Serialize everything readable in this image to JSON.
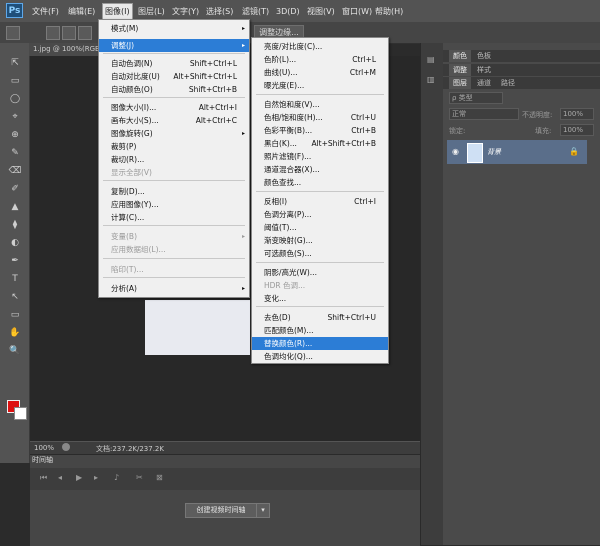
{
  "app": {
    "logo": "Ps"
  },
  "menubar": [
    "文件(F)",
    "编辑(E)",
    "图像(I)",
    "图层(L)",
    "文字(Y)",
    "选择(S)",
    "滤镜(T)",
    "3D(D)",
    "视图(V)",
    "窗口(W)",
    "帮助(H)"
  ],
  "options": {
    "refine_label": "调整边缘..."
  },
  "document": {
    "tab": "1.jpg @ 100%(RGB/8)",
    "zoom": "100%",
    "doc_size": "文档:237.2K/237.2K"
  },
  "image_menu": [
    {
      "label": "模式(M)",
      "shortcut": "",
      "arrow": "▸",
      "disabled": false,
      "hl": false
    },
    {
      "label": "调整(J)",
      "shortcut": "",
      "arrow": "▸",
      "disabled": false,
      "hl": true
    },
    {
      "label": "自动色调(N)",
      "shortcut": "Shift+Ctrl+L",
      "arrow": "",
      "disabled": false,
      "hl": false
    },
    {
      "label": "自动对比度(U)",
      "shortcut": "Alt+Shift+Ctrl+L",
      "arrow": "",
      "disabled": false,
      "hl": false
    },
    {
      "label": "自动颜色(O)",
      "shortcut": "Shift+Ctrl+B",
      "arrow": "",
      "disabled": false,
      "hl": false
    },
    {
      "label": "图像大小(I)...",
      "shortcut": "Alt+Ctrl+I",
      "arrow": "",
      "disabled": false,
      "hl": false
    },
    {
      "label": "画布大小(S)...",
      "shortcut": "Alt+Ctrl+C",
      "arrow": "",
      "disabled": false,
      "hl": false
    },
    {
      "label": "图像旋转(G)",
      "shortcut": "",
      "arrow": "▸",
      "disabled": false,
      "hl": false
    },
    {
      "label": "裁剪(P)",
      "shortcut": "",
      "arrow": "",
      "disabled": false,
      "hl": false
    },
    {
      "label": "裁切(R)...",
      "shortcut": "",
      "arrow": "",
      "disabled": false,
      "hl": false
    },
    {
      "label": "显示全部(V)",
      "shortcut": "",
      "arrow": "",
      "disabled": true,
      "hl": false
    },
    {
      "label": "复制(D)...",
      "shortcut": "",
      "arrow": "",
      "disabled": false,
      "hl": false
    },
    {
      "label": "应用图像(Y)...",
      "shortcut": "",
      "arrow": "",
      "disabled": false,
      "hl": false
    },
    {
      "label": "计算(C)...",
      "shortcut": "",
      "arrow": "",
      "disabled": false,
      "hl": false
    },
    {
      "label": "变量(B)",
      "shortcut": "",
      "arrow": "▸",
      "disabled": true,
      "hl": false
    },
    {
      "label": "应用数据组(L)...",
      "shortcut": "",
      "arrow": "",
      "disabled": true,
      "hl": false
    },
    {
      "label": "陷印(T)...",
      "shortcut": "",
      "arrow": "",
      "disabled": true,
      "hl": false
    },
    {
      "label": "分析(A)",
      "shortcut": "",
      "arrow": "▸",
      "disabled": false,
      "hl": false
    }
  ],
  "adjust_menu": [
    {
      "label": "亮度/对比度(C)...",
      "shortcut": "",
      "disabled": false,
      "hl": false
    },
    {
      "label": "色阶(L)...",
      "shortcut": "Ctrl+L",
      "disabled": false,
      "hl": false
    },
    {
      "label": "曲线(U)...",
      "shortcut": "Ctrl+M",
      "disabled": false,
      "hl": false
    },
    {
      "label": "曝光度(E)...",
      "shortcut": "",
      "disabled": false,
      "hl": false
    },
    {
      "label": "自然饱和度(V)...",
      "shortcut": "",
      "disabled": false,
      "hl": false
    },
    {
      "label": "色相/饱和度(H)...",
      "shortcut": "Ctrl+U",
      "disabled": false,
      "hl": false
    },
    {
      "label": "色彩平衡(B)...",
      "shortcut": "Ctrl+B",
      "disabled": false,
      "hl": false
    },
    {
      "label": "黑白(K)...",
      "shortcut": "Alt+Shift+Ctrl+B",
      "disabled": false,
      "hl": false
    },
    {
      "label": "照片滤镜(F)...",
      "shortcut": "",
      "disabled": false,
      "hl": false
    },
    {
      "label": "通道混合器(X)...",
      "shortcut": "",
      "disabled": false,
      "hl": false
    },
    {
      "label": "颜色查找...",
      "shortcut": "",
      "disabled": false,
      "hl": false
    },
    {
      "label": "反相(I)",
      "shortcut": "Ctrl+I",
      "disabled": false,
      "hl": false
    },
    {
      "label": "色调分离(P)...",
      "shortcut": "",
      "disabled": false,
      "hl": false
    },
    {
      "label": "阈值(T)...",
      "shortcut": "",
      "disabled": false,
      "hl": false
    },
    {
      "label": "渐变映射(G)...",
      "shortcut": "",
      "disabled": false,
      "hl": false
    },
    {
      "label": "可选颜色(S)...",
      "shortcut": "",
      "disabled": false,
      "hl": false
    },
    {
      "label": "阴影/高光(W)...",
      "shortcut": "",
      "disabled": false,
      "hl": false
    },
    {
      "label": "HDR 色调...",
      "shortcut": "",
      "disabled": true,
      "hl": false
    },
    {
      "label": "变化...",
      "shortcut": "",
      "disabled": false,
      "hl": false
    },
    {
      "label": "去色(D)",
      "shortcut": "Shift+Ctrl+U",
      "disabled": false,
      "hl": false
    },
    {
      "label": "匹配颜色(M)...",
      "shortcut": "",
      "disabled": false,
      "hl": false
    },
    {
      "label": "替换颜色(R)...",
      "shortcut": "",
      "disabled": false,
      "hl": true
    },
    {
      "label": "色调均化(Q)...",
      "shortcut": "",
      "disabled": false,
      "hl": false
    }
  ],
  "panels": {
    "top_tabs": [
      "颜色",
      "色板"
    ],
    "mid_tabs": [
      "调整",
      "样式"
    ],
    "layer_tabs": [
      "图层",
      "通道",
      "路径"
    ],
    "kind_label": "ρ 类型",
    "blend_mode": "正常",
    "opacity_label": "不透明度:",
    "opacity_value": "100%",
    "lock_label": "锁定:",
    "fill_label": "填充:",
    "fill_value": "100%",
    "layer_name": "背景"
  },
  "timeline": {
    "tab": "时间轴",
    "create_button": "创建视频时间轴",
    "dropdown": "▾"
  },
  "tools": [
    "⇱",
    "▭",
    "◯",
    "⌖",
    "⊕",
    "✎",
    "⌫",
    "✐",
    "▲",
    "⧫",
    "◐",
    "✒",
    "T",
    "↖",
    "▭",
    "✋",
    "🔍"
  ],
  "colors": {
    "accent": "#2c7dd6",
    "foreground": "#dd1111",
    "background": "#ffffff"
  }
}
